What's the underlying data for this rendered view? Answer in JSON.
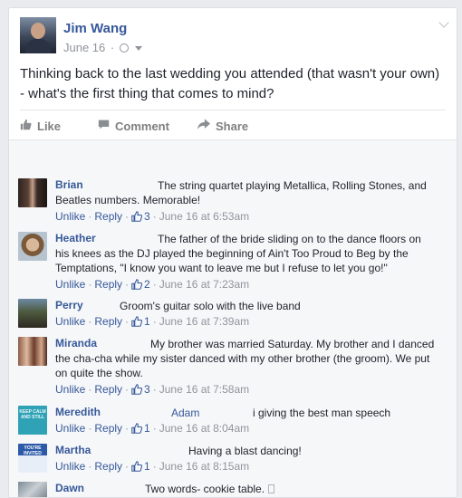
{
  "post": {
    "author": "Jim Wang",
    "date": "June 16",
    "separator": "·",
    "text": "Thinking back to the last wedding you attended (that wasn't your own) - what's the first thing that comes to mind?"
  },
  "actions": {
    "like": "Like",
    "comment": "Comment",
    "share": "Share"
  },
  "comment_links": {
    "unlike": "Unlike",
    "reply": "Reply",
    "dot": "·"
  },
  "comments": [
    {
      "name": "Brian",
      "text_first": "The string quartet playing Metallica, Rolling Stones, and",
      "text_rest": "Beatles numbers. Memorable!",
      "likes": "3",
      "time": "June 16 at 6:53am"
    },
    {
      "name": "Heather",
      "text_first": "The father of the bride sliding on to the dance floors on",
      "text_rest": "his knees as the DJ played the beginning of Ain't Too Proud to Beg by the Temptations, \"I know you want to leave me but I refuse to let you go!\"",
      "likes": "2",
      "time": "June 16 at 7:23am"
    },
    {
      "name": "Perry",
      "text_first": "Groom's guitar solo with the live band",
      "text_rest": "",
      "likes": "1",
      "time": "June 16 at 7:39am"
    },
    {
      "name": "Miranda",
      "text_first": "My brother was married Saturday. My brother and I danced",
      "text_rest": "the cha-cha while my sister danced with my other brother (the groom). We put on quite the show.",
      "likes": "3",
      "time": "June 16 at 7:58am"
    },
    {
      "name": "Meredith",
      "mention": "Adam",
      "text_first": "i giving the best man speech",
      "text_rest": "",
      "likes": "1",
      "time": "June 16 at 8:04am"
    },
    {
      "name": "Martha",
      "text_first": "Having a blast dancing!",
      "text_rest": "",
      "likes": "1",
      "time": "June 16 at 8:15am"
    },
    {
      "name": "Dawn",
      "text_first": "Two words- cookie table.",
      "text_rest": ""
    }
  ],
  "avatar_texts": {
    "meredith": "KEEP CALM AND STILL",
    "martha": "YOU'RE INVITED"
  },
  "icons": {
    "globe": "globe-icon",
    "caret": "caret-down-icon",
    "options": "chevron-down-icon",
    "like": "thumbs-up-icon",
    "comment": "comment-bubble-icon",
    "share": "share-arrow-icon"
  },
  "colors": {
    "link_blue": "#365899",
    "meta_gray": "#90949c",
    "background": "#e9ebee"
  }
}
